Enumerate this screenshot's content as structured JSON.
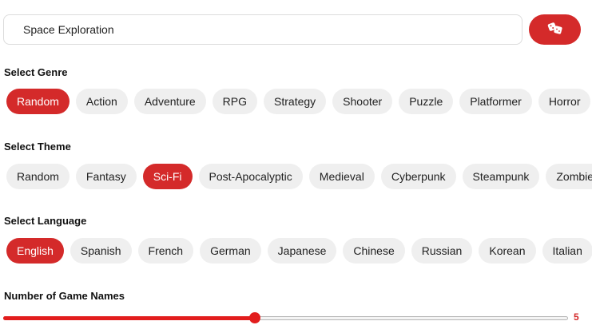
{
  "search": {
    "value": "Space Exploration"
  },
  "dice_button": {
    "icon": "dice-icon"
  },
  "genre": {
    "label": "Select Genre",
    "options": [
      "Random",
      "Action",
      "Adventure",
      "RPG",
      "Strategy",
      "Shooter",
      "Puzzle",
      "Platformer",
      "Horror"
    ],
    "selected": "Random"
  },
  "theme": {
    "label": "Select Theme",
    "options": [
      "Random",
      "Fantasy",
      "Sci-Fi",
      "Post-Apocalyptic",
      "Medieval",
      "Cyberpunk",
      "Steampunk",
      "Zombie"
    ],
    "selected": "Sci-Fi"
  },
  "language": {
    "label": "Select Language",
    "options": [
      "English",
      "Spanish",
      "French",
      "German",
      "Japanese",
      "Chinese",
      "Russian",
      "Korean",
      "Italian"
    ],
    "selected": "English"
  },
  "count": {
    "label": "Number of Game Names",
    "value": "5",
    "fraction": 0.445
  },
  "colors": {
    "accent": "#d42a2a",
    "slider": "#e21d1d",
    "chip_bg": "#efefef"
  }
}
